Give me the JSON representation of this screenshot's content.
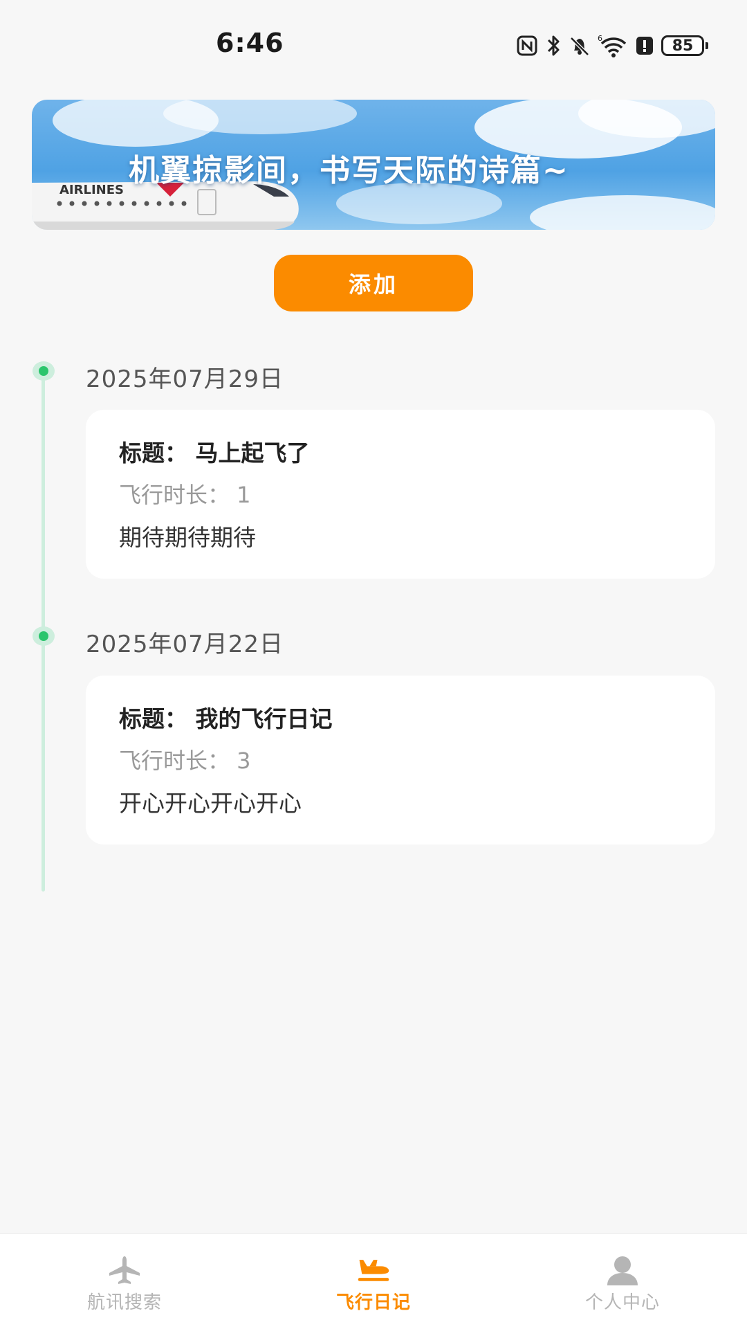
{
  "status_bar": {
    "time": "6:46",
    "battery_level": "85",
    "icons": [
      "nfc-icon",
      "bluetooth-icon",
      "bell-off-icon",
      "wifi-icon",
      "alert-icon",
      "battery-icon"
    ]
  },
  "banner": {
    "slogan": "机翼掠影间，书写天际的诗篇~",
    "plane_livery": "AIRLINES"
  },
  "add_button": {
    "label": "添加"
  },
  "timeline": {
    "entries": [
      {
        "date": "2025年07月29日",
        "title": "标题： 马上起飞了",
        "duration": "飞行时长： 1",
        "content": "期待期待期待"
      },
      {
        "date": "2025年07月22日",
        "title": "标题： 我的飞行日记",
        "duration": "飞行时长： 3",
        "content": "开心开心开心开心"
      }
    ]
  },
  "tab_bar": {
    "tabs": [
      {
        "label": "航讯搜索",
        "icon": "airplane-icon",
        "active": false
      },
      {
        "label": "飞行日记",
        "icon": "plane-landing-icon",
        "active": true
      },
      {
        "label": "个人中心",
        "icon": "person-icon",
        "active": false
      }
    ]
  },
  "colors": {
    "accent": "#fb8b00",
    "timeline_dot": "#2bc56c",
    "timeline_line": "#cdeedd",
    "background": "#f7f7f7"
  }
}
